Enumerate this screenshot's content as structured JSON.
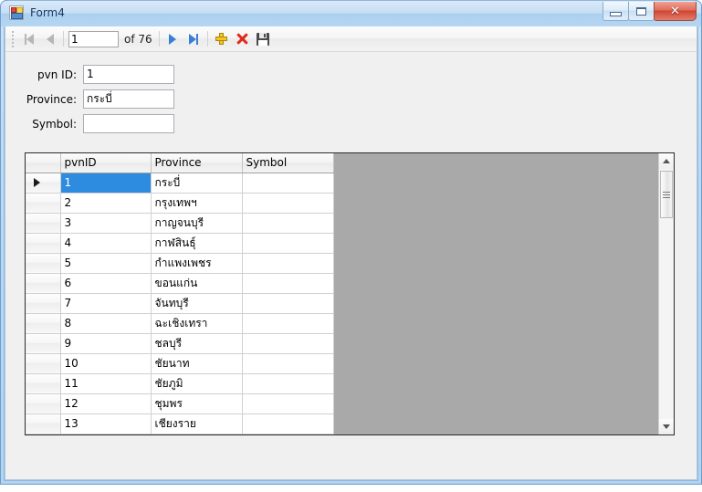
{
  "window": {
    "title": "Form4",
    "icon": "winforms-app-icon",
    "buttons": {
      "minimize": "minimize-button",
      "maximize": "maximize-button",
      "close": "✕"
    }
  },
  "navigator": {
    "first_icon": "first-record-icon",
    "previous_icon": "previous-record-icon",
    "position_value": "1",
    "count_label": "of 76",
    "next_icon": "next-record-icon",
    "last_icon": "last-record-icon",
    "add_icon": "add-record-icon",
    "delete_icon": "delete-record-icon",
    "save_icon": "save-data-icon"
  },
  "details": {
    "fields": [
      {
        "label": "pvn ID:",
        "value": "1",
        "placeholder": ""
      },
      {
        "label": "Province:",
        "value": "กระบี่",
        "placeholder": ""
      },
      {
        "label": "Symbol:",
        "value": "",
        "placeholder": ""
      }
    ]
  },
  "grid": {
    "columns": [
      "pvnID",
      "Province",
      "Symbol"
    ],
    "selected_row_index": 0,
    "rows": [
      {
        "pvnID": "1",
        "Province": "กระบี่",
        "Symbol": ""
      },
      {
        "pvnID": "2",
        "Province": "กรุงเทพฯ",
        "Symbol": ""
      },
      {
        "pvnID": "3",
        "Province": "กาญจนบุรี",
        "Symbol": ""
      },
      {
        "pvnID": "4",
        "Province": "กาฬสินธุ์",
        "Symbol": ""
      },
      {
        "pvnID": "5",
        "Province": "กำแพงเพชร",
        "Symbol": ""
      },
      {
        "pvnID": "6",
        "Province": "ขอนแก่น",
        "Symbol": ""
      },
      {
        "pvnID": "7",
        "Province": "จันทบุรี",
        "Symbol": ""
      },
      {
        "pvnID": "8",
        "Province": "ฉะเชิงเทรา",
        "Symbol": ""
      },
      {
        "pvnID": "9",
        "Province": "ชลบุรี",
        "Symbol": ""
      },
      {
        "pvnID": "10",
        "Province": "ชัยนาท",
        "Symbol": ""
      },
      {
        "pvnID": "11",
        "Province": "ชัยภูมิ",
        "Symbol": ""
      },
      {
        "pvnID": "12",
        "Province": "ชุมพร",
        "Symbol": ""
      },
      {
        "pvnID": "13",
        "Province": "เชียงราย",
        "Symbol": ""
      }
    ]
  },
  "colors": {
    "selection": "#2e8ce0",
    "grid_background": "#a9a9a9",
    "form_background": "#f0f0f0",
    "title_bar": "#b4d3f0",
    "close_button": "#cf4533",
    "add_icon": "#f5c518",
    "delete_icon": "#e02b1c",
    "nav_arrow_enabled": "#3a7fd5",
    "nav_arrow_disabled": "#b6b6b6"
  }
}
